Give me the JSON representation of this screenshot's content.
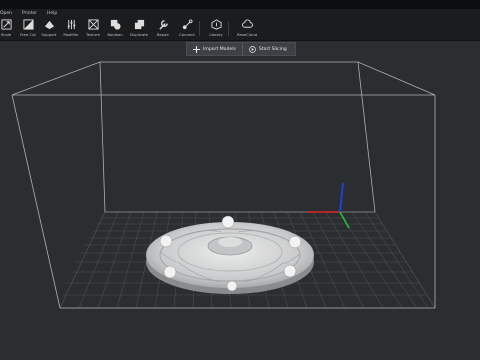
{
  "menu": [
    "Open",
    "Printer",
    "Help"
  ],
  "toolbar": [
    {
      "label": "Scale",
      "icon": "scale-icon"
    },
    {
      "label": "Free Cut",
      "icon": "free-cut-icon"
    },
    {
      "label": "Support",
      "icon": "support-icon"
    },
    {
      "label": "Modifier",
      "icon": "modifier-icon"
    },
    {
      "label": "Texture",
      "icon": "texture-icon"
    },
    {
      "label": "Boolean",
      "icon": "boolean-icon"
    },
    {
      "label": "Duplicate",
      "icon": "duplicate-icon"
    },
    {
      "label": "Repair",
      "icon": "repair-icon"
    },
    {
      "label": "Connect",
      "icon": "connect-icon"
    },
    {
      "label": "Library",
      "icon": "library-icon"
    },
    {
      "label": "RaseCloud",
      "icon": "cloud-icon"
    }
  ],
  "actions": {
    "import_label": "Import Models",
    "slice_label": "Start Slicing"
  },
  "colors": {
    "background": "#2b2e31",
    "grid": "#4a4d50",
    "axis_x": "#e0252b",
    "axis_y": "#23c23a",
    "axis_z": "#2040e8",
    "model": "#d6d7d8"
  }
}
